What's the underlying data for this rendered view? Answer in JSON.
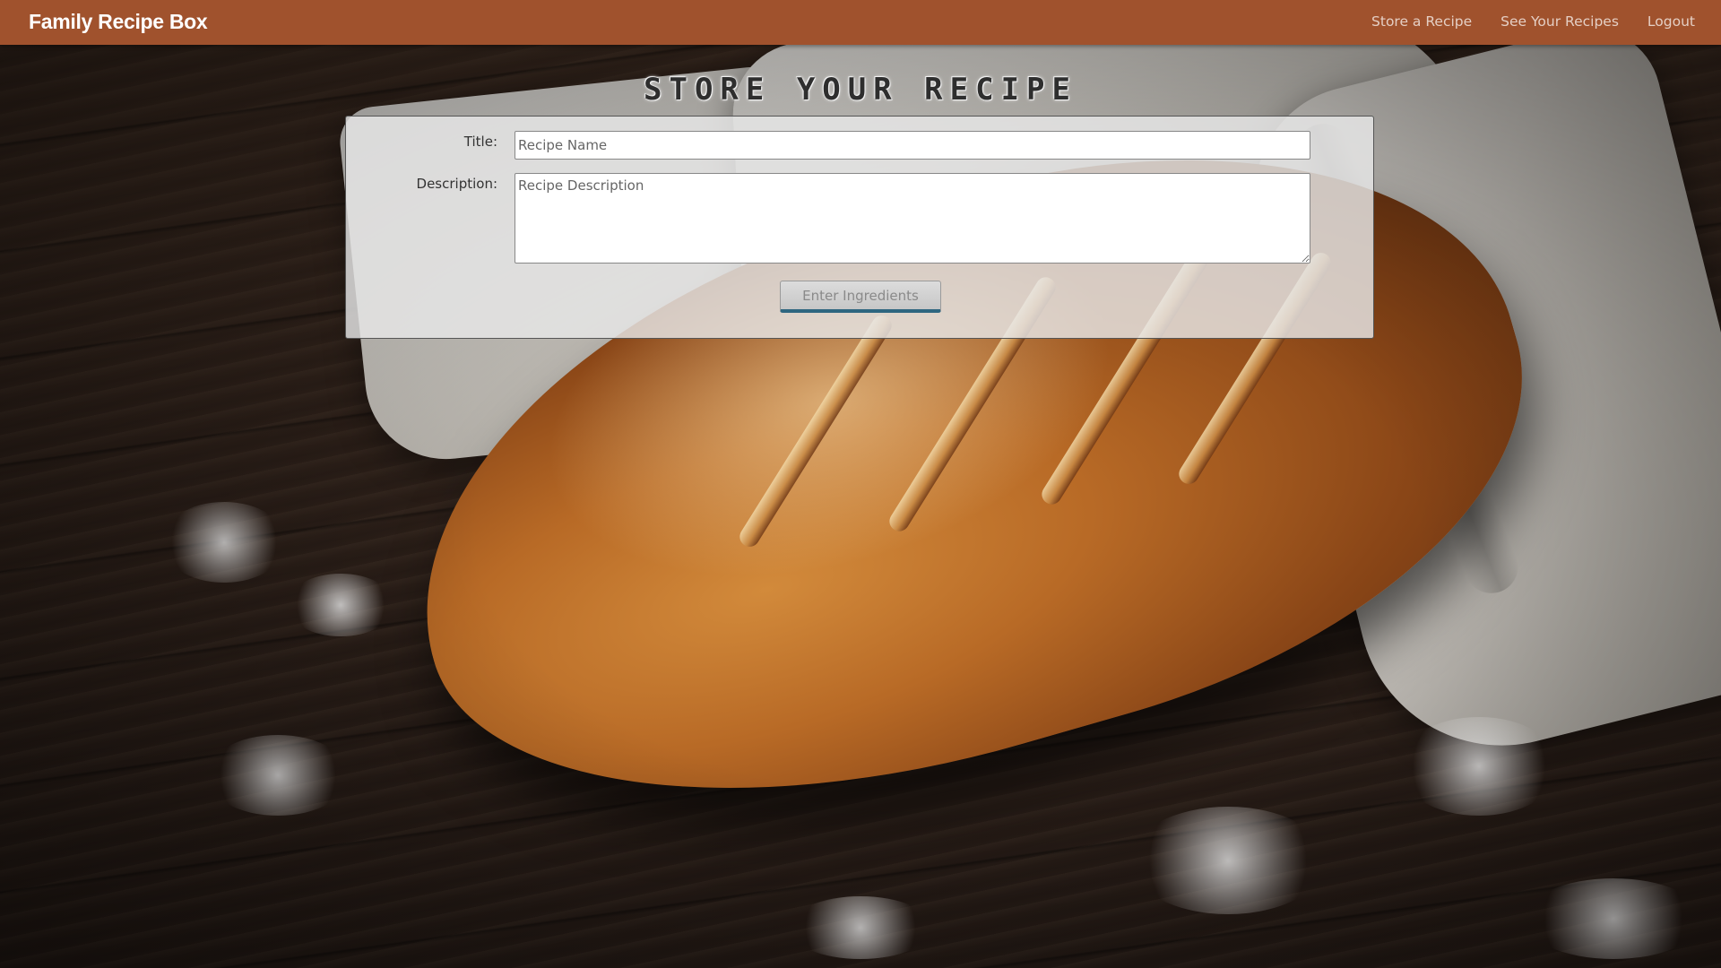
{
  "navbar": {
    "brand": "Family Recipe Box",
    "links": [
      {
        "label": "Store a Recipe"
      },
      {
        "label": "See Your Recipes"
      },
      {
        "label": "Logout"
      }
    ],
    "background_color": "#a0522d"
  },
  "page": {
    "title": "STORE YOUR RECIPE"
  },
  "form": {
    "title_label": "Title:",
    "title_placeholder": "Recipe Name",
    "title_value": "",
    "description_label": "Description:",
    "description_placeholder": "Recipe Description",
    "description_value": "",
    "submit_label": "Enter Ingredients"
  },
  "colors": {
    "accent": "#a0522d",
    "button_underline": "#2e6680"
  }
}
